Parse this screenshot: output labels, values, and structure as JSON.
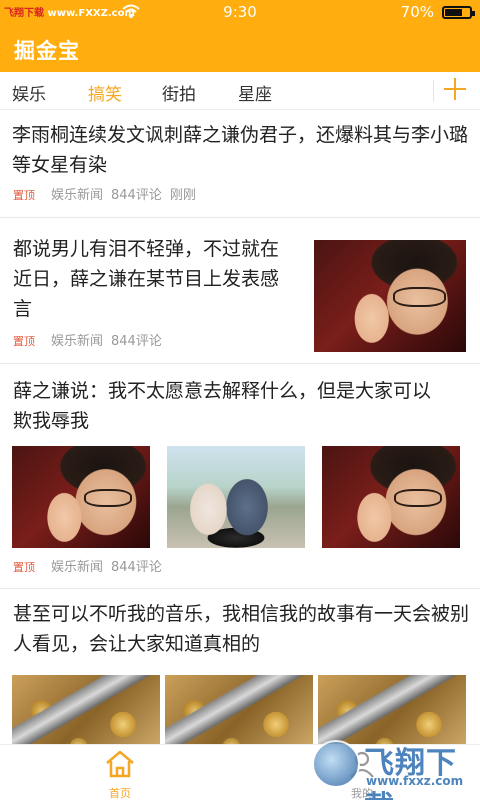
{
  "status_bar": {
    "source_prefix": "飞翔下载",
    "source_url": "www.FXXZ.com",
    "time": "9:30",
    "battery": "70%",
    "battery_level": 0.7
  },
  "header": {
    "title": "掘金宝"
  },
  "tabs": [
    {
      "label": "娱乐",
      "active": false
    },
    {
      "label": "搞笑",
      "active": true
    },
    {
      "label": "街拍",
      "active": false
    },
    {
      "label": "星座",
      "active": false
    }
  ],
  "feed": [
    {
      "title": "李雨桐连续发文讽刺薛之谦伪君子，还爆料其与李小璐等女星有染",
      "pin": "置顶",
      "source": "娱乐新闻",
      "comments": "844评论",
      "time": "刚刚"
    },
    {
      "title": "都说男儿有泪不轻弹，不过就在近日，薛之谦在某节目上发表感言",
      "pin": "置顶",
      "source": "娱乐新闻",
      "comments": "844评论"
    },
    {
      "title": "薛之谦说：我不太愿意去解释什么，但是大家可以欺我辱我",
      "pin": "置顶",
      "source": "娱乐新闻",
      "comments": "844评论"
    },
    {
      "title": "甚至可以不听我的音乐，我相信我的故事有一天会被别人看见，会让大家知道真相的"
    }
  ],
  "bottom_nav": [
    {
      "label": "首页",
      "icon": "home-icon",
      "active": true
    },
    {
      "label": "我的",
      "icon": "user-icon",
      "active": false
    }
  ],
  "watermark": {
    "text": "飞翔下载",
    "url": "www.fxxz.com"
  },
  "colors": {
    "accent": "#ffad0f",
    "active_tab": "#f5a623",
    "pin": "#e25a3b"
  }
}
